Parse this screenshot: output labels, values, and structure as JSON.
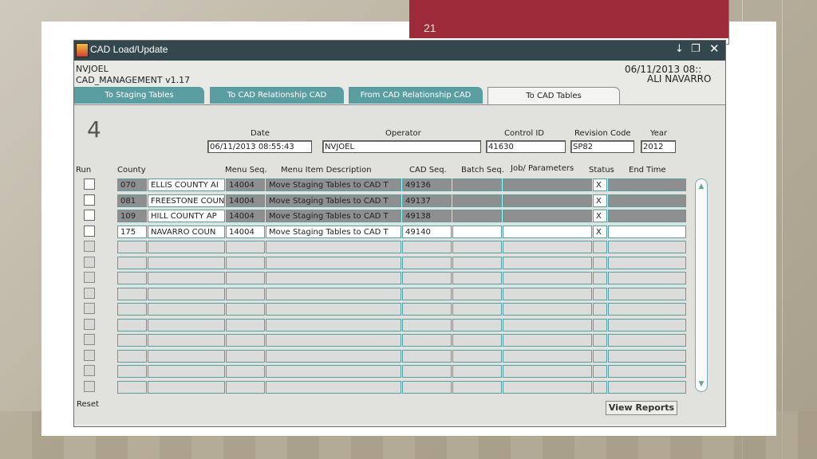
{
  "slide": {
    "number": "21"
  },
  "window": {
    "title": "CAD Load/Update",
    "controls": [
      "minimize-icon",
      "restore-icon",
      "close-icon"
    ]
  },
  "header": {
    "user": "NVJOEL",
    "app_version": "CAD_MANAGEMENT v1.17",
    "datetime": "06/11/2013 08::",
    "location": "ALI NAVARRO"
  },
  "tabs": [
    {
      "label": "To Staging Tables",
      "active": false
    },
    {
      "label": "To CAD Relationship CAD",
      "active": false
    },
    {
      "label": "From CAD Relationship CAD",
      "active": false
    },
    {
      "label": "To CAD Tables",
      "active": true
    }
  ],
  "form": {
    "number": "4",
    "date_label": "Date",
    "date_value": "06/11/2013 08:55:43",
    "operator_label": "Operator",
    "operator_value": "NVJOEL",
    "control_id_label": "Control ID",
    "control_id_value": "41630",
    "revision_code_label": "Revision Code",
    "revision_code_value": "SP82",
    "year_label": "Year",
    "year_value": "2012"
  },
  "columns": [
    "Run",
    "County",
    "Menu Seq.",
    "Menu Item Description",
    "CAD Seq.",
    "Batch Seq.",
    "Job/ Parameters",
    "Status",
    "End Time"
  ],
  "rows": [
    {
      "county_code": "070",
      "county_name": "ELLIS COUNTY AI",
      "menu_seq": "14004",
      "description": "Move Staging Tables to CAD T",
      "cad_seq": "49136",
      "batch_seq": "",
      "job": "",
      "status": "X",
      "end_time": "",
      "greyed": true
    },
    {
      "county_code": "081",
      "county_name": "FREESTONE COUN",
      "menu_seq": "14004",
      "description": "Move Staging Tables to CAD T",
      "cad_seq": "49137",
      "batch_seq": "",
      "job": "",
      "status": "X",
      "end_time": "",
      "greyed": true
    },
    {
      "county_code": "109",
      "county_name": "HILL COUNTY AP",
      "menu_seq": "14004",
      "description": "Move Staging Tables to CAD T",
      "cad_seq": "49138",
      "batch_seq": "",
      "job": "",
      "status": "X",
      "end_time": "",
      "greyed": true
    },
    {
      "county_code": "175",
      "county_name": "NAVARRO COUN",
      "menu_seq": "14004",
      "description": "Move Staging Tables to CAD T",
      "cad_seq": "49140",
      "batch_seq": "",
      "job": "",
      "status": "X",
      "end_time": "",
      "greyed": false
    }
  ],
  "empty_rows": 10,
  "buttons": {
    "reset": "Reset",
    "view_reports": "View Reports"
  },
  "colors": {
    "titlebar": "#33474d",
    "tab": "#5a9ea2",
    "slide_accent": "#9c2a38",
    "grey_cell": "#8f8f8f"
  }
}
